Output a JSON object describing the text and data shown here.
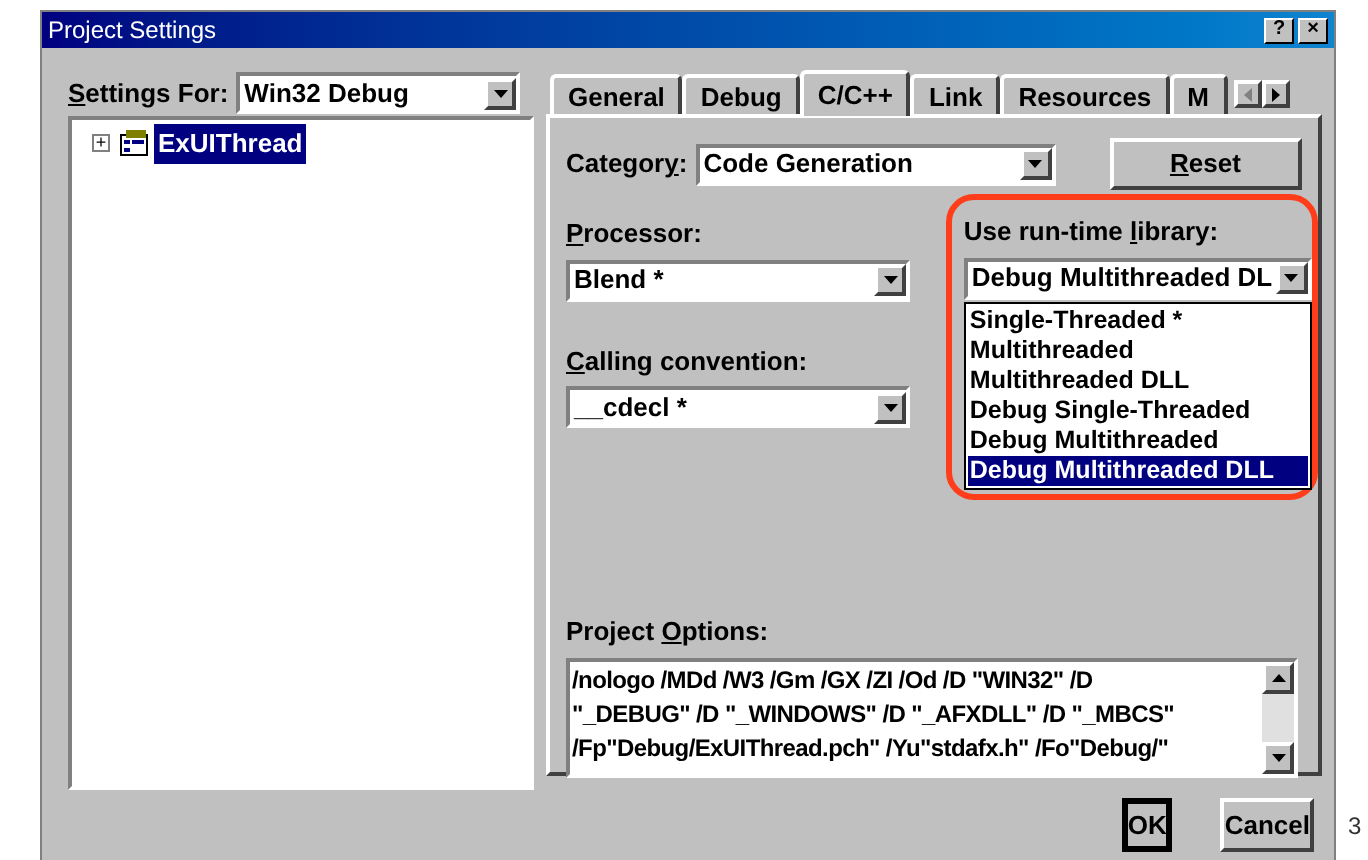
{
  "window": {
    "title": "Project Settings",
    "title_buttons": [
      "?",
      "×"
    ]
  },
  "settings_for": {
    "label": {
      "key": "S",
      "after": "ettings For:"
    },
    "value": "Win32 Debug"
  },
  "tree": {
    "items": [
      {
        "label": "ExUIThread",
        "selected": true,
        "expander": "+"
      }
    ]
  },
  "tabs": [
    {
      "label": "General",
      "selected": false
    },
    {
      "label": "Debug",
      "selected": false
    },
    {
      "label": "C/C++",
      "selected": true
    },
    {
      "label": "Link",
      "selected": false
    },
    {
      "label": "Resources",
      "selected": false
    },
    {
      "label": "M",
      "selected": false
    }
  ],
  "category": {
    "label": {
      "before": "Categor",
      "key": "y",
      "after": ":"
    },
    "value": "Code Generation"
  },
  "reset_button": {
    "key": "R",
    "after": "eset"
  },
  "processor": {
    "label": {
      "key": "P",
      "after": "rocessor:"
    },
    "value": "Blend *"
  },
  "calling_convention": {
    "label": {
      "key": "C",
      "after": "alling convention:"
    },
    "value": "__cdecl *"
  },
  "runtime_library": {
    "label": {
      "before": "Use run-time ",
      "key": "l",
      "after": "ibrary:"
    },
    "value": "Debug Multithreaded DL",
    "highlighted": true,
    "expanded": true,
    "options": [
      {
        "label": "Single-Threaded *",
        "selected": false
      },
      {
        "label": "Multithreaded",
        "selected": false
      },
      {
        "label": "Multithreaded DLL",
        "selected": false
      },
      {
        "label": "Debug Single-Threaded",
        "selected": false
      },
      {
        "label": "Debug Multithreaded",
        "selected": false
      },
      {
        "label": "Debug Multithreaded DLL",
        "selected": true
      }
    ]
  },
  "project_options": {
    "label": {
      "before": "Project ",
      "key": "O",
      "after": "ptions:"
    },
    "lines": [
      "/nologo /MDd /W3 /Gm /GX /ZI /Od /D \"WIN32\" /D",
      "\"_DEBUG\" /D \"_WINDOWS\" /D \"_AFXDLL\" /D \"_MBCS\"",
      "/Fp\"Debug/ExUIThread.pch\" /Yu\"stdafx.h\" /Fo\"Debug/\""
    ]
  },
  "buttons": [
    "OK",
    "Cancel"
  ],
  "page_number": "3"
}
